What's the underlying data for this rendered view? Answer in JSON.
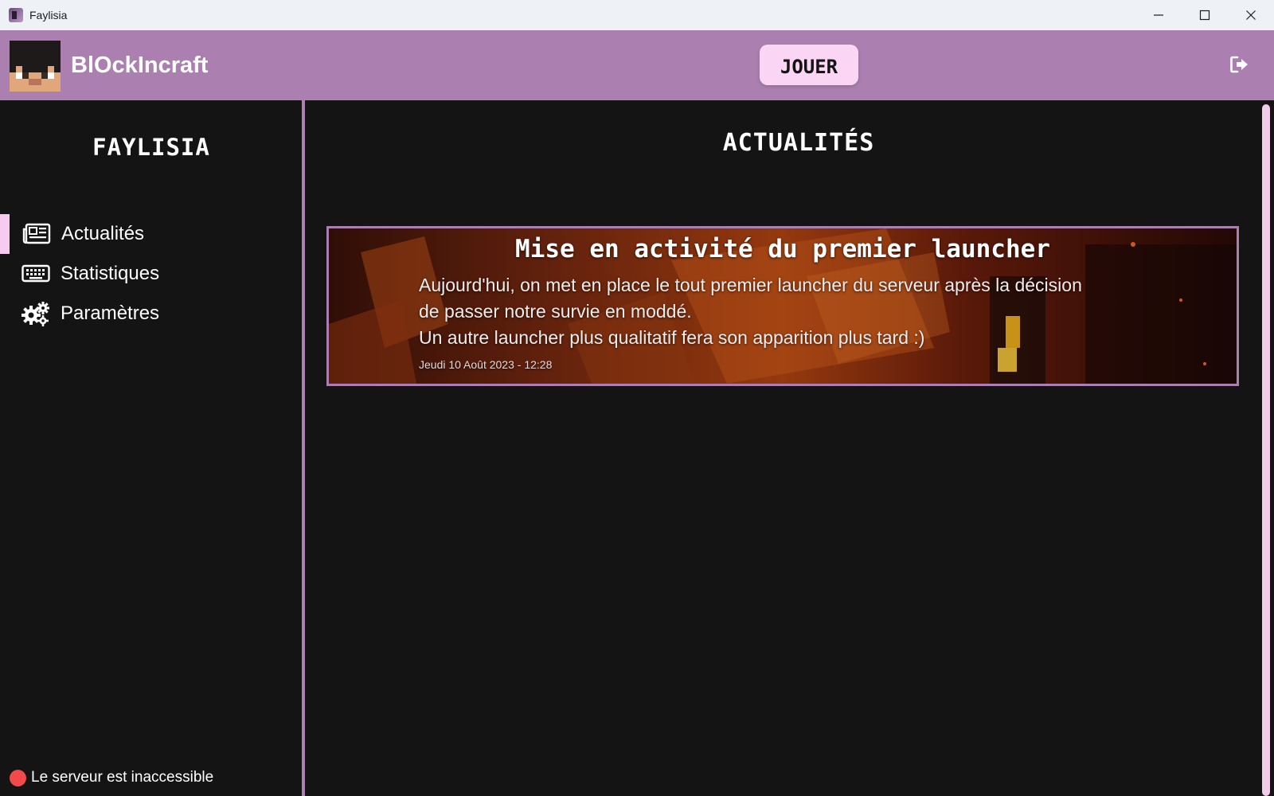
{
  "window": {
    "title": "Faylisia",
    "icons": {
      "app": "faylisia-app-icon",
      "minimize": "minimize-icon",
      "maximize": "maximize-icon",
      "close": "close-icon"
    }
  },
  "header": {
    "username": "BlOckIncraft",
    "avatar_icon": "player-skin-head",
    "play_label": "JOUER",
    "logout_icon": "logout-icon",
    "accent_color": "#ab7faf",
    "play_button_color": "#fbd6f4"
  },
  "sidebar": {
    "server_name": "FAYLISIA",
    "items": [
      {
        "label": "Actualités",
        "icon": "newspaper-icon",
        "active": true
      },
      {
        "label": "Statistiques",
        "icon": "keyboard-icon",
        "active": false
      },
      {
        "label": "Paramètres",
        "icon": "gears-icon",
        "active": false
      }
    ],
    "active_indicator_color": "#f7cbf1",
    "status": {
      "text": "Le serveur est inaccessible",
      "color": "#f24a4a"
    }
  },
  "main": {
    "title": "ACTUALITÉS",
    "news": [
      {
        "title": "Mise en activité du premier launcher",
        "body_lines": [
          "Aujourd'hui, on met en place le tout premier launcher du serveur après la décision",
          "de passer notre survie en moddé.",
          "Un autre launcher plus qualitatif fera son apparition plus tard :)"
        ],
        "date": "Jeudi 10 Août 2023 - 12:28"
      }
    ]
  }
}
